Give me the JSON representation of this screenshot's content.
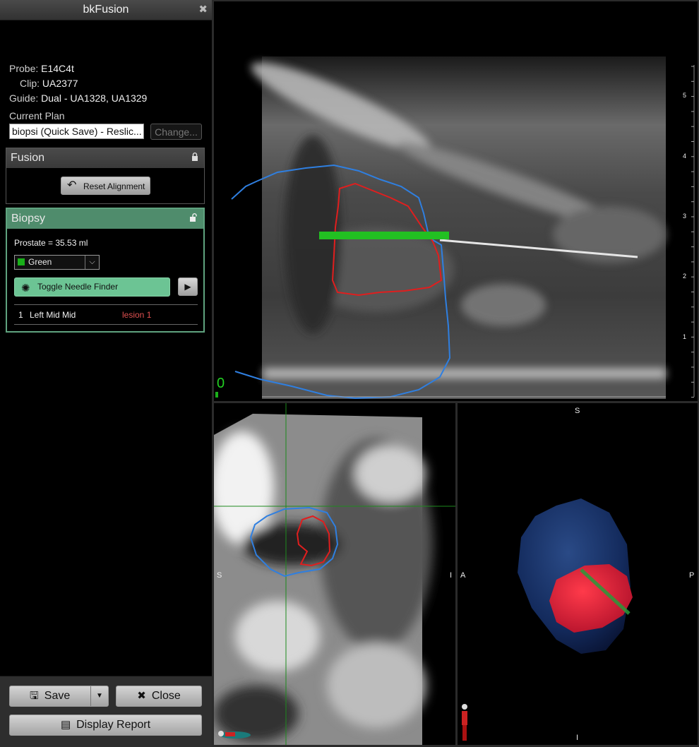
{
  "window": {
    "title": "bkFusion",
    "close_glyph": "✖"
  },
  "info": {
    "probe_label": "Probe:",
    "probe_value": "E14C4t",
    "clip_label": "Clip:",
    "clip_value": "UA2377",
    "guide_label": "Guide:",
    "guide_value": "Dual - UA1328, UA1329",
    "current_plan_label": "Current Plan",
    "current_plan_value": "biopsi (Quick Save) - Reslic...",
    "change_button": "Change..."
  },
  "fusion": {
    "title": "Fusion",
    "lock_icon": "lock-closed-icon",
    "reset_button": "Reset Alignment"
  },
  "biopsy": {
    "title": "Biopsy",
    "lock_icon": "lock-open-icon",
    "prostate_volume": "Prostate = 35.53 ml",
    "color_select": "Green",
    "color_hex": "#1aaf1a",
    "needle_finder_button": "Toggle Needle Finder",
    "targets": [
      {
        "index": "1",
        "location": "Left Mid Mid",
        "lesion": "lesion 1"
      }
    ]
  },
  "footer": {
    "save_button": "Save",
    "close_button": "Close",
    "report_button": "Display Report"
  },
  "viewports": {
    "ultrasound": {
      "scale_ticks": [
        "5",
        "4",
        "3",
        "2",
        "1"
      ],
      "corner_label": "0"
    },
    "sagittal": {
      "left_label": "S",
      "right_label": "I"
    },
    "model_3d": {
      "top_label": "S",
      "bottom_label": "I",
      "left_label": "A",
      "right_label": "P"
    }
  },
  "colors": {
    "prostate_contour": "#2f7fe0",
    "lesion_contour": "#e01e1e",
    "needle": "#22c022",
    "biopsy_header": "#4f8c6c"
  }
}
